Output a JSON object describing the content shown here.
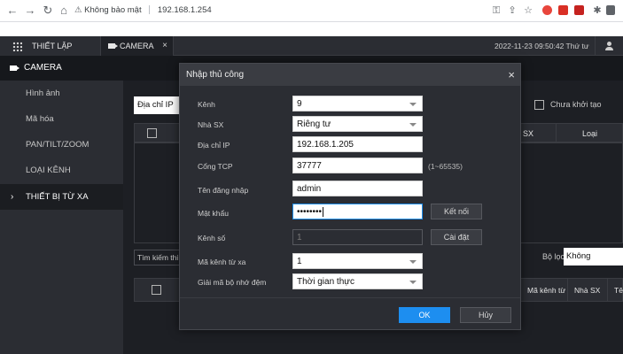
{
  "browser": {
    "security_warning": "Không bảo mật",
    "url": "192.168.1.254"
  },
  "header": {
    "setup_tab": "THIẾT LẬP",
    "camera_tab": "CAMERA",
    "close_glyph": "×",
    "datetime": "2022-11-23 09:50:42 Thứ tư"
  },
  "section": {
    "title": "CAMERA"
  },
  "sidebar": {
    "items": [
      {
        "label": "Hình ảnh",
        "active": false
      },
      {
        "label": "Mã hóa",
        "active": false
      },
      {
        "label": "PAN/TILT/ZOOM",
        "active": false
      },
      {
        "label": "LOẠI KÊNH",
        "active": false
      },
      {
        "label": "THIẾT BỊ TỪ XA",
        "active": true
      }
    ]
  },
  "main": {
    "address_select": "Địa chỉ IP",
    "uninitialized_label": "Chưa khởi tạo",
    "table1_headers": [
      "SX",
      "Loại"
    ],
    "search_placeholder": "Tìm kiếm thi...",
    "filter_label": "Bộ lọc",
    "filter_value": "Không",
    "table2_headers": [
      "Mã kênh từ",
      "Nhà SX",
      "Tê"
    ]
  },
  "modal": {
    "title": "Nhập thủ công",
    "close_glyph": "×",
    "fields": {
      "channel_label": "Kênh",
      "channel_value": "9",
      "manufacturer_label": "Nhà SX",
      "manufacturer_value": "Riêng tư",
      "ip_label": "Địa chỉ IP",
      "ip_value": "192.168.1.205",
      "port_label": "Cổng TCP",
      "port_value": "37777",
      "port_hint": "(1~65535)",
      "username_label": "Tên đăng nhập",
      "username_value": "admin",
      "password_label": "Mật khẩu",
      "password_value": "••••••••",
      "connect_button": "Kết nối",
      "channel_no_label": "Kênh số",
      "channel_no_value": "1",
      "settings_button": "Cài đặt",
      "remote_channel_label": "Mã kênh từ xa",
      "remote_channel_value": "1",
      "decode_buffer_label": "Giải mã bộ nhớ đệm",
      "decode_buffer_value": "Thời gian thực"
    },
    "ok_button": "OK",
    "cancel_button": "Hủy"
  }
}
